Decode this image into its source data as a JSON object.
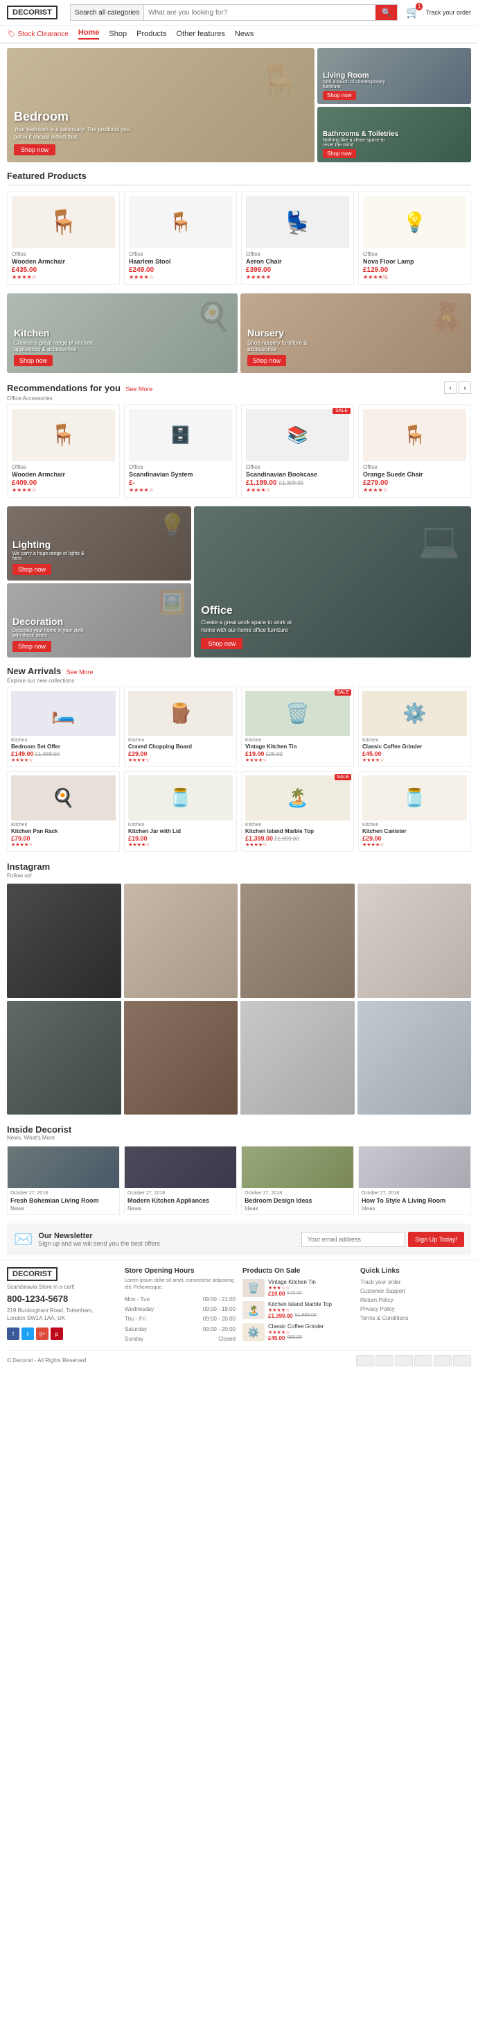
{
  "header": {
    "logo": "DECORIST",
    "search_category": "Search all categories",
    "search_placeholder": "What are you looking for?",
    "cart_count": "1",
    "track_order": "Track your order"
  },
  "nav": {
    "items": [
      {
        "label": "Home",
        "active": true
      },
      {
        "label": "Shop"
      },
      {
        "label": "Products"
      },
      {
        "label": "Other features"
      },
      {
        "label": "News"
      }
    ],
    "stock_clearance": "Stock Clearance"
  },
  "hero": {
    "main": {
      "title": "Bedroom",
      "subtitle": "Your bedroom is a sanctuary. The products you put in it should reflect that.",
      "btn": "Shop now"
    },
    "side_top": {
      "title": "Living Room",
      "subtitle": "Add a touch of contemporary furniture",
      "btn": "Shop now"
    },
    "side_bottom": {
      "title": "Bathrooms & Toiletries",
      "subtitle": "Nothing like a clean space to reset the mind",
      "btn": "Shop now"
    }
  },
  "featured_products": {
    "title": "Featured Products",
    "items": [
      {
        "category": "Office",
        "name": "Wooden Armchair",
        "price": "£435.00",
        "rating": "★★★★☆"
      },
      {
        "category": "Office",
        "name": "Haarlem Stool",
        "price": "£249.00",
        "rating": "★★★★☆"
      },
      {
        "category": "Office",
        "name": "Aeron Chair",
        "price": "£399.00",
        "rating": "★★★★★"
      },
      {
        "category": "Office",
        "name": "Nova Floor Lamp",
        "price": "£129.00",
        "rating": "★★★★½"
      }
    ]
  },
  "banners": {
    "kitchen": {
      "title": "Kitchen",
      "desc": "Choose a great range of kitchen appliances & accessories",
      "btn": "Shop now"
    },
    "nursery": {
      "title": "Nursery",
      "desc": "Shop nursery furniture & accessories",
      "btn": "Shop now"
    }
  },
  "recommendations": {
    "title": "Recommendations for you",
    "see_more": "See More",
    "subtitle": "Office Accessories",
    "items": [
      {
        "category": "Office",
        "name": "Wooden Armchair",
        "price": "£409.00",
        "rating": "★★★★☆"
      },
      {
        "category": "Office",
        "name": "Scandinavian System",
        "price": "£-",
        "rating": "★★★★☆"
      },
      {
        "category": "Office",
        "name": "Scandinavian Bookcase",
        "price": "£1,189.00",
        "old_price": "£1,309.00",
        "rating": "★★★★☆",
        "badge": "SALE"
      },
      {
        "category": "Office",
        "name": "Orange Suede Chair",
        "price": "£279.00",
        "rating": "★★★★☆"
      }
    ]
  },
  "category_banners": {
    "lighting": {
      "title": "Lighting",
      "desc": "We carry a huge range of lights & fans",
      "btn": "Shop now"
    },
    "decoration": {
      "title": "Decoration",
      "desc": "Decorate your home in your style with these items",
      "btn": "Shop now"
    },
    "office": {
      "title": "Office",
      "desc": "Create a great work space to work at home with our home office furniture",
      "btn": "Shop now"
    }
  },
  "new_arrivals": {
    "title": "New Arrivals",
    "see_more": "See More",
    "subtitle": "Explore our new collections",
    "items": [
      {
        "category": "Kitchen",
        "name": "Bedroom Set Offer",
        "price": "£149.00",
        "old_price": "£1,369.00",
        "rating": "★★★★☆"
      },
      {
        "category": "Kitchen",
        "name": "Craved Chopping Board",
        "price": "£29.00",
        "rating": "★★★★☆"
      },
      {
        "category": "Kitchen",
        "name": "Vintage Kitchen Tin",
        "price": "£19.00",
        "old_price": "£25.00",
        "rating": "★★★★☆",
        "badge": "SALE"
      },
      {
        "category": "Kitchen",
        "name": "Classic Coffee Grinder",
        "price": "£45.00",
        "rating": "★★★★☆"
      },
      {
        "category": "Kitchen",
        "name": "Kitchen Pan Rack",
        "price": "£79.00",
        "rating": "★★★★☆"
      },
      {
        "category": "Kitchen",
        "name": "Kitchen Jar with Lid",
        "price": "£19.00",
        "rating": "★★★★☆"
      },
      {
        "category": "Kitchen",
        "name": "Kitchen Island Marble Top",
        "price": "£1,399.00",
        "old_price": "£1,999.00",
        "rating": "★★★★☆",
        "badge": "SALE"
      },
      {
        "category": "Kitchen",
        "name": "Kitchen Canister",
        "price": "£29.00",
        "rating": "★★★★☆"
      }
    ]
  },
  "instagram": {
    "title": "Instagram",
    "subtitle": "Follow us!"
  },
  "blog": {
    "title": "Inside Decorist",
    "subtitle": "News, What's More",
    "items": [
      {
        "date": "October 27, 2018",
        "title": "Fresh Bohemian Living Room",
        "category": "News"
      },
      {
        "date": "October 27, 2018",
        "title": "Modern Kitchen Appliances",
        "category": "News"
      },
      {
        "date": "October 27, 2018",
        "title": "Bedroom Design Ideas",
        "category": "Ideas"
      },
      {
        "date": "October 27, 2018",
        "title": "How To Style A Living Room",
        "category": "Ideas"
      }
    ]
  },
  "newsletter": {
    "title": "Our Newsletter",
    "subtitle": "Sign up and we will send you the best offers",
    "input_placeholder": "Your email address",
    "btn_label": "Sign Up Today!"
  },
  "footer": {
    "logo": "DECORIST",
    "tagline": "Scandinavia Store in a cart!",
    "phone": "800-1234-5678",
    "address": "219 Buckingham Road, Tottenham,\nLondon SW1A 1AA, UK",
    "store_hours": {
      "title": "Store Opening Hours",
      "desc": "Lorem ipsum dolor sit amet, consectetur adipiscing elit. Pellentesque.",
      "hours": [
        {
          "days": "Mon - Tue",
          "time": "09:00 - 21:00"
        },
        {
          "days": "Wednesday",
          "time": "09:00 - 19:00"
        },
        {
          "days": "Thu - Fri",
          "time": "09:00 - 20:00"
        },
        {
          "days": "Saturday",
          "time": "09:00 - 20:00"
        },
        {
          "days": "Sunday",
          "time": "Closed"
        }
      ]
    },
    "products_on_sale": {
      "title": "Products On Sale",
      "items": [
        {
          "name": "Vintage Kitchen Tin",
          "price": "£19.00",
          "old_price": "£25.00",
          "rating": "★★★☆☆"
        },
        {
          "name": "Kitchen Island Marble Top",
          "price": "£1,399.00",
          "old_price": "£1,999.00",
          "rating": "★★★★☆"
        },
        {
          "name": "Classic Coffee Grinder",
          "price": "£45.00",
          "old_price": "£65.00",
          "rating": "★★★★☆"
        }
      ]
    },
    "quick_links": {
      "title": "Quick Links",
      "links": [
        "Track your order",
        "Customer Support",
        "Return Policy",
        "Privacy Policy",
        "Terms & Conditions"
      ]
    },
    "copyright": "© Decorist - All Rights Reserved",
    "social": [
      "f",
      "t",
      "g+",
      "p"
    ]
  }
}
